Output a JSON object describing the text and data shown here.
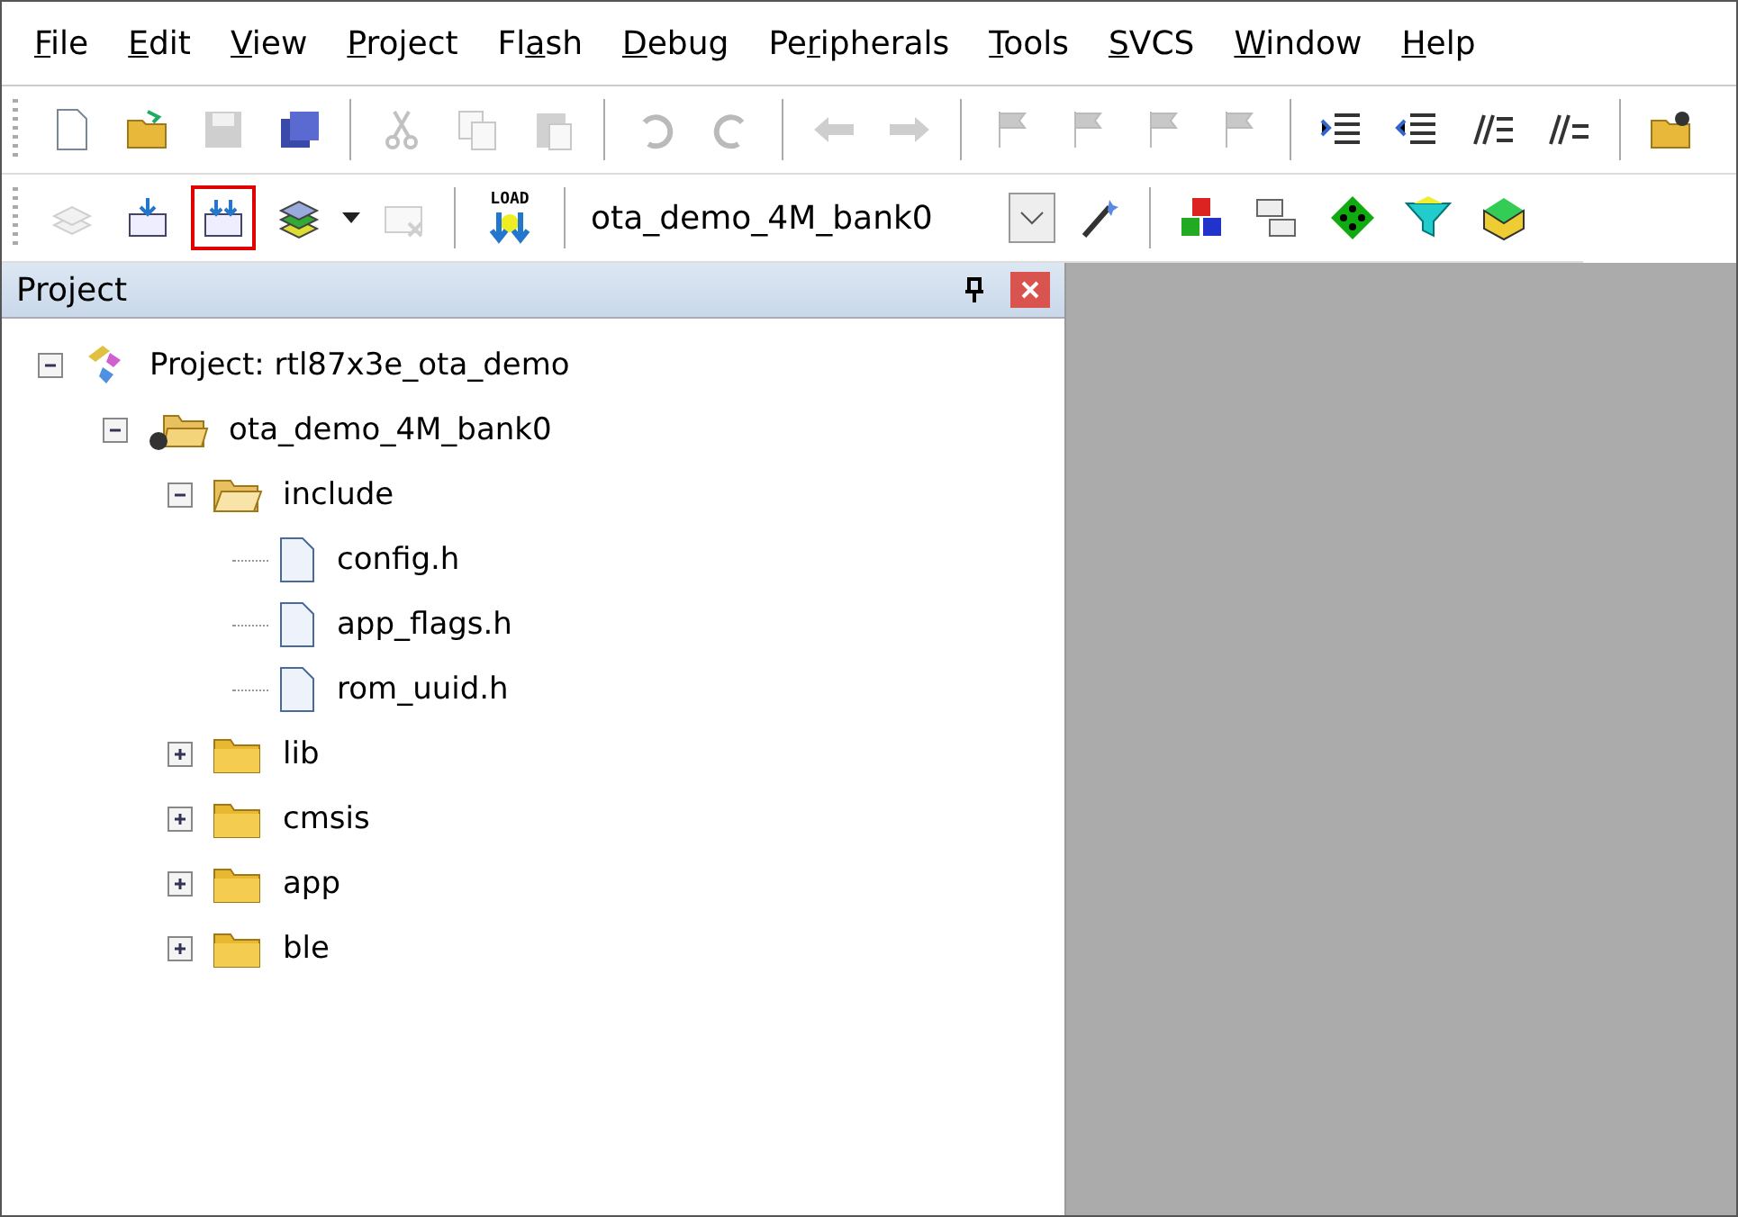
{
  "menu": [
    {
      "mnemonic": "F",
      "after": "ile"
    },
    {
      "mnemonic": "E",
      "after": "dit"
    },
    {
      "mnemonic": "V",
      "after": "iew"
    },
    {
      "mnemonic": "P",
      "after": "roject"
    },
    {
      "before": "Fl",
      "mnemonic": "a",
      "after": "sh"
    },
    {
      "mnemonic": "D",
      "after": "ebug"
    },
    {
      "before": "Pe",
      "mnemonic": "r",
      "after": "ipherals"
    },
    {
      "mnemonic": "T",
      "after": "ools"
    },
    {
      "mnemonic": "S",
      "after": "VCS"
    },
    {
      "mnemonic": "W",
      "after": "indow"
    },
    {
      "mnemonic": "H",
      "after": "elp"
    }
  ],
  "toolbar_1": {
    "buttons": [
      {
        "disabled": false
      },
      {
        "disabled": false
      },
      {
        "disabled": true
      },
      {
        "disabled": false
      },
      {
        "disabled": true
      },
      {
        "disabled": true
      },
      {
        "disabled": true
      },
      {
        "disabled": true
      },
      {
        "disabled": true
      },
      {
        "disabled": true
      },
      {
        "disabled": true
      },
      {
        "disabled": true
      },
      {
        "disabled": true
      },
      {
        "disabled": true
      },
      {
        "disabled": true
      },
      {
        "disabled": false
      },
      {
        "disabled": false
      },
      {
        "disabled": false
      },
      {
        "disabled": false
      },
      {
        "disabled": false
      }
    ]
  },
  "toolbar_2": {
    "buttons": [
      {
        "disabled": true,
        "highlighted": false
      },
      {
        "disabled": false,
        "highlighted": false
      },
      {
        "disabled": false,
        "highlighted": true
      },
      {
        "disabled": false,
        "highlighted": false
      },
      {
        "disabled": true,
        "highlighted": false
      }
    ],
    "load_label": "LOAD",
    "target": "ota_demo_4M_bank0"
  },
  "project_panel": {
    "title": "Project",
    "tree": [
      {
        "kind": "project",
        "label": "Project: rtl87x3e_ota_demo",
        "expanded": true,
        "children": [
          {
            "kind": "target",
            "label": "ota_demo_4M_bank0",
            "expanded": true,
            "children": [
              {
                "kind": "folder",
                "label": "include",
                "expanded": true,
                "children": [
                  {
                    "kind": "file",
                    "label": "config.h"
                  },
                  {
                    "kind": "file",
                    "label": "app_flags.h"
                  },
                  {
                    "kind": "file",
                    "label": "rom_uuid.h"
                  }
                ]
              },
              {
                "kind": "folder",
                "label": "lib",
                "expanded": false
              },
              {
                "kind": "folder",
                "label": "cmsis",
                "expanded": false
              },
              {
                "kind": "folder",
                "label": "app",
                "expanded": false
              },
              {
                "kind": "folder",
                "label": "ble",
                "expanded": false
              }
            ]
          }
        ]
      }
    ]
  }
}
